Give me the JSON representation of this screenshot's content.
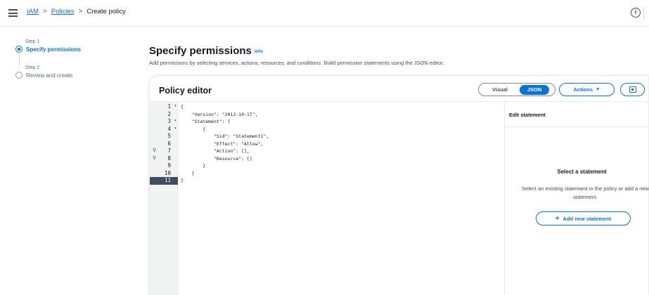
{
  "breadcrumb": {
    "items": [
      {
        "label": "IAM",
        "link": true
      },
      {
        "label": "Policies",
        "link": true
      },
      {
        "label": "Create policy",
        "link": false
      }
    ],
    "separator": ">"
  },
  "topbar": {
    "info_icon": "i"
  },
  "wizard": {
    "steps": [
      {
        "step_label": "Step 1",
        "title": "Specify permissions",
        "state": "active"
      },
      {
        "step_label": "Step 2",
        "title": "Review and create",
        "state": "inactive"
      }
    ]
  },
  "header": {
    "title": "Specify permissions",
    "info_link": "Info",
    "description": "Add permissions by selecting services, actions, resources, and conditions. Build permission statements using the JSON editor."
  },
  "editor": {
    "title": "Policy editor",
    "toggle_visual": "Visual",
    "toggle_json": "JSON",
    "actions_label": "Actions",
    "mode_selected": "JSON",
    "gutter": [
      {
        "num": "1",
        "fold": "▾",
        "lint": ""
      },
      {
        "num": "2",
        "fold": "",
        "lint": ""
      },
      {
        "num": "3",
        "fold": "▾",
        "lint": ""
      },
      {
        "num": "4",
        "fold": "▾",
        "lint": ""
      },
      {
        "num": "5",
        "fold": "",
        "lint": ""
      },
      {
        "num": "6",
        "fold": "",
        "lint": ""
      },
      {
        "num": "7",
        "fold": "",
        "lint": "⚲"
      },
      {
        "num": "8",
        "fold": "",
        "lint": "⚲"
      },
      {
        "num": "9",
        "fold": "",
        "lint": ""
      },
      {
        "num": "10",
        "fold": "",
        "lint": ""
      },
      {
        "num": "11",
        "fold": "",
        "lint": ""
      }
    ],
    "lines": [
      "{",
      "    \"Version\": \"2012-10-17\",",
      "    \"Statement\": [",
      "        {",
      "            \"Sid\": \"Statement1\",",
      "            \"Effect\": \"Allow\",",
      "            \"Action\": [],",
      "            \"Resource\": []",
      "        }",
      "    ]",
      "}"
    ],
    "selected_line": "11"
  },
  "side_panel": {
    "header": "Edit statement",
    "empty_title": "Select a statement",
    "empty_desc": "Select an existing statement in the policy or add a new statement.",
    "add_button": "Add new statement"
  },
  "colors": {
    "accent": "#0972d3",
    "text": "#16191f",
    "muted": "#5f6b7a"
  }
}
